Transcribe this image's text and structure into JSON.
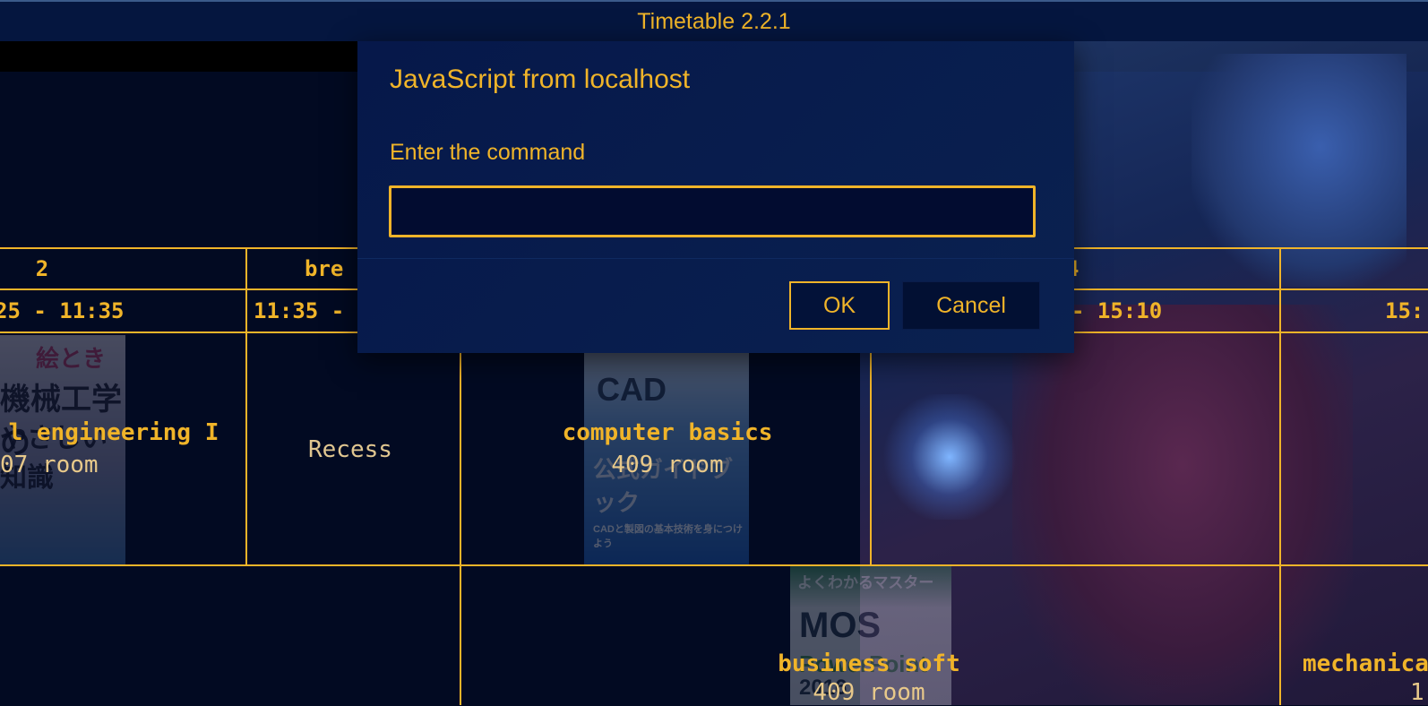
{
  "window": {
    "title": "Timetable 2.2.1"
  },
  "table": {
    "periods": [
      "2",
      "bre",
      "4"
    ],
    "times": [
      "25 - 11:35",
      "11:35 -",
      "- 15:10",
      "15:"
    ],
    "rows": [
      {
        "cells": [
          {
            "name": "l engineering I",
            "room": "07 room"
          },
          {
            "recess": "Recess"
          },
          {
            "name": "computer basics",
            "room": "409 room"
          }
        ]
      },
      {
        "cells": [
          {
            "name": "business soft",
            "room": "409 room"
          },
          {
            "name": "mechanica",
            "room": "1"
          }
        ]
      }
    ]
  },
  "background_books": {
    "book1": [
      "絵とき",
      "機械工学の",
      "やさしい知識"
    ],
    "book2": [
      "CAD",
      "公式ガイドブック",
      "CADと製図の基本技術を身につけよう"
    ],
    "book3": [
      "よくわかるマスター",
      "MOS",
      "PowerPoint",
      "2016"
    ]
  },
  "dialog": {
    "title": "JavaScript from localhost",
    "message": "Enter the command",
    "input_value": "",
    "ok_label": "OK",
    "cancel_label": "Cancel"
  },
  "colors": {
    "accent": "#f0b429",
    "background": "#020a22",
    "dialog_bg": "#06184a"
  }
}
